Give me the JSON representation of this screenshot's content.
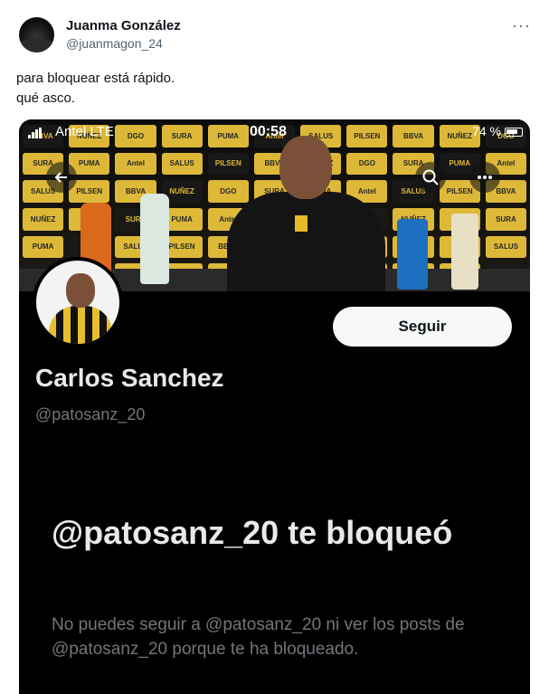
{
  "tweet": {
    "author_name": "Juanma González",
    "author_handle": "@juanmagon_24",
    "more_icon": "more-horizontal-icon",
    "more_label": "···",
    "text_line1": "para bloquear está rápido.",
    "text_line2": "qué asco."
  },
  "phone_screenshot": {
    "status_bar": {
      "carrier": "Antel  LTE",
      "time": "00:58",
      "right": "74 %"
    },
    "nav": {
      "back_icon": "arrow-left-icon",
      "search_icon": "search-icon",
      "more_icon": "more-horizontal-icon"
    },
    "banner_sponsors": [
      "BBVA",
      "NUÑEZ",
      "DGO",
      "SURA",
      "PUMA",
      "Antel",
      "SALUS",
      "PILSEN"
    ],
    "profile": {
      "display_name": "Carlos Sanchez",
      "handle": "@patosanz_20",
      "follow_label": "Seguir"
    },
    "blocked": {
      "title": "@patosanz_20 te bloqueó",
      "description": "No puedes seguir a @patosanz_20 ni ver los posts de @patosanz_20 porque te ha bloqueado."
    }
  },
  "colors": {
    "background": "#ffffff",
    "text_primary": "#0f1419",
    "text_secondary": "#536471",
    "dark_bg": "#000000",
    "dark_text": "#e7e9ea",
    "dark_muted": "#71767b",
    "banner_yellow": "#e9c23b"
  }
}
